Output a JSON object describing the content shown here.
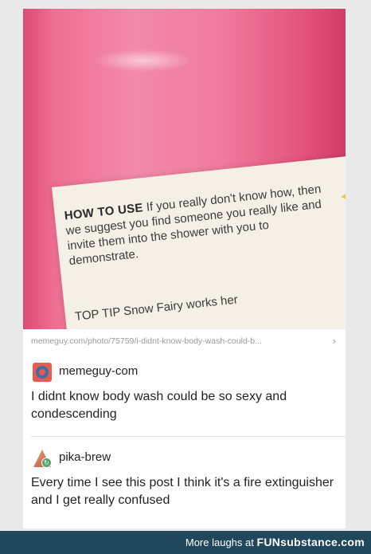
{
  "photo": {
    "label_heading": "HOW TO USE",
    "label_body": "If you really don't know how, then we suggest you find someone you really like and invite them into the shower with you to demonstrate.",
    "label_tip": "TOP TIP Snow Fairy works her"
  },
  "url_bar": {
    "url": "memeguy.com/photo/75759/i-didnt-know-body-wash-could-b...",
    "chevron_icon": "chevron-right-icon"
  },
  "comments": [
    {
      "username": "memeguy-com",
      "text": "I didnt know body wash could be so sexy and condescending"
    },
    {
      "username": "pika-brew",
      "text": "Every time I see this post I think it's a fire extinguisher and I get really confused"
    }
  ],
  "footer": {
    "prefix": "More laughs at",
    "brand": "FUNsubstance.com"
  },
  "colors": {
    "footer_bg": "#20475b",
    "bottle_pink": "#f07a9d"
  }
}
